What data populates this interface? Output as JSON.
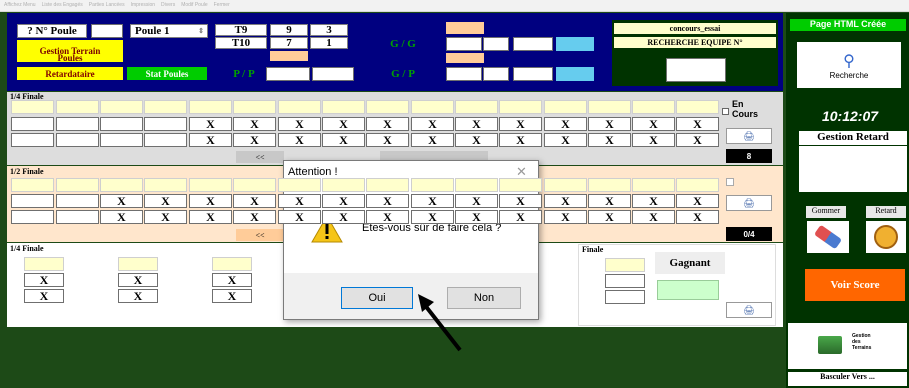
{
  "menubar": [
    "Affichez Menu",
    "Liste des Engagés",
    "Parties Lancées",
    "Impression",
    "Divers",
    "Modif Poule",
    "Fermer"
  ],
  "top": {
    "poule_label": "? N° Poule",
    "poule_value": "Poule 1",
    "t9": "T9",
    "t10": "T10",
    "n9": "9",
    "n3": "3",
    "n7": "7",
    "n1": "1",
    "gg": "G / G",
    "gp": "G / P",
    "pp": "P / P",
    "gestion_terrain": "Gestion Terrain",
    "poules": "Poules",
    "retardataire": "Retardataire",
    "stat_poules": "Stat Poules",
    "concours": "concours_essai",
    "recherche_equipe": "RECHERCHE EQUIPE N°"
  },
  "quarter": {
    "title": "1/4 Finale",
    "x": "X",
    "en_cours": "En\nCours",
    "count": "8",
    "nav_left": "<<"
  },
  "semi": {
    "title": "1/2 Finale",
    "x": "X",
    "count": "0/4",
    "nav_left": "<<"
  },
  "bottom": {
    "title": "1/4 Finale",
    "x": "X",
    "finale": "Finale",
    "gagnant": "Gagnant"
  },
  "sidebar": {
    "page_html": "Page HTML Créée",
    "recherche": "Recherche",
    "time": "10:12:07",
    "gestion_retard": "Gestion Retard",
    "gommer": "Gommer",
    "retard": "Retard",
    "voir_score": "Voir Score",
    "gestion_terrains": "Gestion\ndes\nTerrains",
    "basculer": "Basculer Vers ..."
  },
  "dialog": {
    "title": "Attention !",
    "message": "Etes-vous sûr de faire cela ?",
    "yes": "Oui",
    "no": "Non"
  }
}
